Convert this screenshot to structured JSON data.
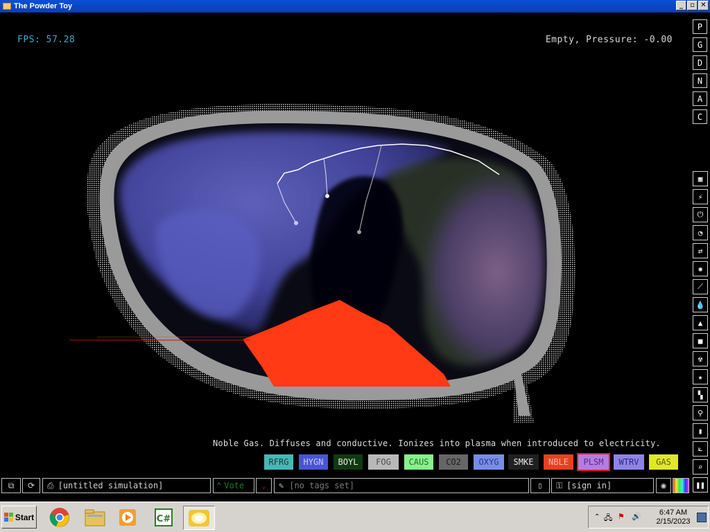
{
  "window": {
    "title": "The Powder Toy",
    "buttons": {
      "minimize": "_",
      "maximize": "▫",
      "close": "✕"
    }
  },
  "hud": {
    "fps": "FPS: 57.28",
    "status": "Empty, Pressure: -0.00"
  },
  "right_toolbar": {
    "top_buttons": [
      "P",
      "G",
      "D",
      "N",
      "A",
      "C"
    ],
    "menu_icons": [
      "walls-icon",
      "electronics-icon",
      "powered-icon",
      "sensors-icon",
      "force-icon",
      "explosives-icon",
      "gases-icon",
      "liquids-icon",
      "powders-icon",
      "solids-icon",
      "radioactive-icon",
      "special-icon",
      "life-icon",
      "tools-icon",
      "favorites-icon",
      "decoration-icon",
      "search-icon",
      "pause-icon"
    ]
  },
  "element_description": "Noble Gas. Diffuses and conductive. Ionizes into plasma when introduced to electricity.",
  "elements": [
    {
      "label": "RFRG",
      "bg": "#47b8b6",
      "fg": "#1a3b3a"
    },
    {
      "label": "HYGN",
      "bg": "#4a55d6",
      "fg": "#c8ccff"
    },
    {
      "label": "BOYL",
      "bg": "#0f3a10",
      "fg": "#e8e8e8"
    },
    {
      "label": "FOG",
      "bg": "#b9b9b9",
      "fg": "#4d4d4d"
    },
    {
      "label": "CAUS",
      "bg": "#86f28c",
      "fg": "#2b6a2f"
    },
    {
      "label": "CO2",
      "bg": "#666666",
      "fg": "#1a1a1a"
    },
    {
      "label": "OXYG",
      "bg": "#7a8de6",
      "fg": "#2a3790"
    },
    {
      "label": "SMKE",
      "bg": "#202020",
      "fg": "#e8e8e8"
    },
    {
      "label": "NBLE",
      "bg": "#e8411f",
      "fg": "#ffb3a0"
    },
    {
      "label": "PLSM",
      "bg": "#b27ee0",
      "fg": "#5b2a8e",
      "selected": true
    },
    {
      "label": "WTRV",
      "bg": "#8e84e8",
      "fg": "#2e2680"
    },
    {
      "label": "GAS",
      "bg": "#dfe82a",
      "fg": "#5c5f00"
    }
  ],
  "bottom_bar": {
    "save_name": "[untitled simulation]",
    "vote_label": "Vote",
    "tags_placeholder": "[no tags set]",
    "signin_label": "[sign in]"
  },
  "taskbar": {
    "start_label": "Start",
    "apps": [
      "chrome-icon",
      "explorer-icon",
      "media-player-icon",
      "csharp-icon",
      "powder-toy-icon"
    ],
    "time": "6:47 AM",
    "date": "2/15/2023"
  }
}
